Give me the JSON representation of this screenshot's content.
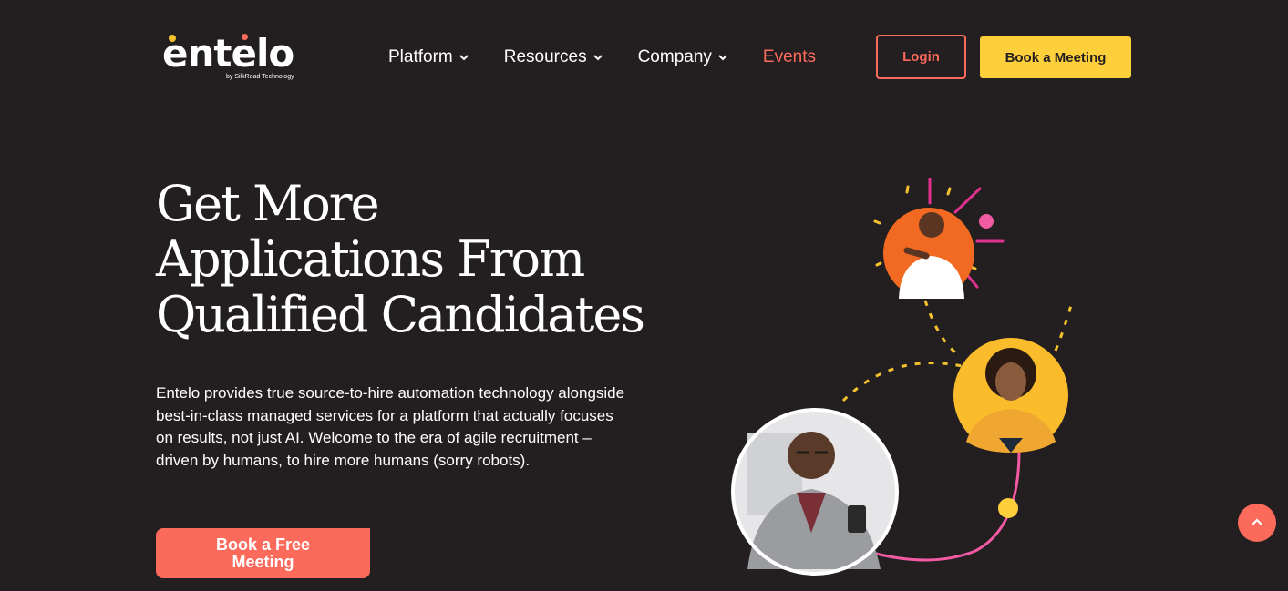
{
  "header": {
    "logo_text": "entelo",
    "logo_sub": "by SilkRoad Technology",
    "nav": [
      {
        "label": "Platform",
        "has_dropdown": true
      },
      {
        "label": "Resources",
        "has_dropdown": true
      },
      {
        "label": "Company",
        "has_dropdown": true
      },
      {
        "label": "Events",
        "has_dropdown": false
      }
    ],
    "login_label": "Login",
    "book_meeting_label": "Book a Meeting"
  },
  "hero": {
    "title": "Get More Applications From Qualified Candidates",
    "description": "Entelo provides true source-to-hire automation technology alongside best-in-class managed services for a platform that actually focuses on results, not just AI. Welcome to the era of agile recruitment – driven by humans, to hire more humans (sorry robots).",
    "cta_label": "Book a Free Meeting"
  },
  "colors": {
    "background": "#231f20",
    "accent_coral": "#fb6a5a",
    "accent_yellow": "#fdcf3b",
    "accent_magenta": "#e0318f",
    "accent_orange": "#f26a21"
  },
  "icons": {
    "nav_dropdown": "chevron-down-icon",
    "scroll_top": "chevron-up-icon"
  }
}
